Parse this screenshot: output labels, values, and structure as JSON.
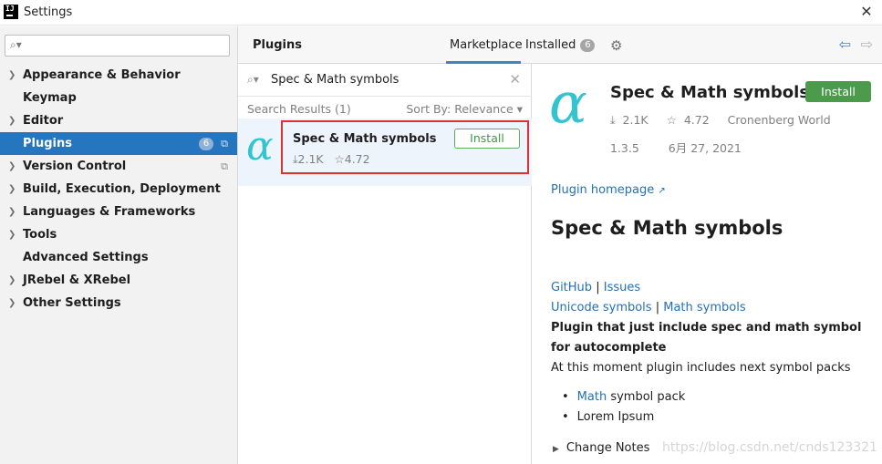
{
  "window": {
    "title": "Settings",
    "app_icon_label": "IJ"
  },
  "sidebar": {
    "search_placeholder": "",
    "items": [
      {
        "label": "Appearance & Behavior",
        "expandable": true
      },
      {
        "label": "Keymap",
        "expandable": false
      },
      {
        "label": "Editor",
        "expandable": true
      },
      {
        "label": "Plugins",
        "expandable": false,
        "selected": true,
        "badge": "6"
      },
      {
        "label": "Version Control",
        "expandable": true
      },
      {
        "label": "Build, Execution, Deployment",
        "expandable": true
      },
      {
        "label": "Languages & Frameworks",
        "expandable": true
      },
      {
        "label": "Tools",
        "expandable": true
      },
      {
        "label": "Advanced Settings",
        "expandable": false
      },
      {
        "label": "JRebel & XRebel",
        "expandable": true
      },
      {
        "label": "Other Settings",
        "expandable": true
      }
    ]
  },
  "header": {
    "title": "Plugins",
    "tabs": [
      {
        "label": "Marketplace",
        "active": true
      },
      {
        "label": "Installed",
        "badge": "6"
      }
    ]
  },
  "search": {
    "value": "Spec & Math symbols",
    "results_label": "Search Results (1)",
    "sort_label": "Sort By: Relevance"
  },
  "result": {
    "name": "Spec & Math symbols",
    "downloads": "2.1K",
    "rating": "4.72",
    "install_label": "Install",
    "logo_glyph": "α"
  },
  "details": {
    "name": "Spec & Math symbols",
    "install_label": "Install",
    "downloads": "2.1K",
    "rating": "4.72",
    "vendor": "Cronenberg World",
    "version": "1.3.5",
    "date": "6月 27, 2021",
    "homepage_label": "Plugin homepage",
    "heading": "Spec & Math symbols",
    "links_row1": [
      "GitHub",
      "Issues"
    ],
    "links_row2": [
      "Unicode symbols",
      "Math symbols"
    ],
    "description_bold": "Plugin that just include spec and math symbol for autocomplete",
    "description": "At this moment plugin includes next symbol packs",
    "list": [
      {
        "link": "Math",
        "text": " symbol pack"
      },
      {
        "link": "",
        "text": "Lorem Ipsum"
      }
    ],
    "change_notes_label": "Change Notes"
  },
  "watermark": "https://blog.csdn.net/cnds123321",
  "colors": {
    "accent": "#2675bf",
    "install_green": "#4c9a4c",
    "highlight_red": "#e03030",
    "logo_teal": "#33c4d0",
    "link": "#2470b3"
  }
}
